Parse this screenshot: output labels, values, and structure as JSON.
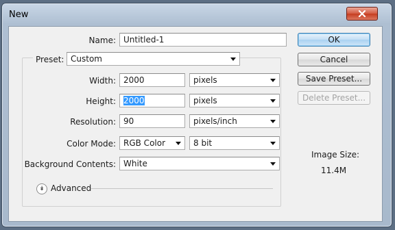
{
  "window": {
    "title": "New"
  },
  "fields": {
    "name": {
      "label": "Name:",
      "value": "Untitled-1"
    },
    "preset": {
      "label": "Preset:",
      "value": "Custom"
    },
    "width": {
      "label": "Width:",
      "value": "2000",
      "unit": "pixels"
    },
    "height": {
      "label": "Height:",
      "value": "2000",
      "unit": "pixels"
    },
    "resolution": {
      "label": "Resolution:",
      "value": "90",
      "unit": "pixels/inch"
    },
    "color_mode": {
      "label": "Color Mode:",
      "value": "RGB Color",
      "depth": "8 bit"
    },
    "background": {
      "label": "Background Contents:",
      "value": "White"
    },
    "advanced": {
      "label": "Advanced"
    }
  },
  "buttons": {
    "ok": "OK",
    "cancel": "Cancel",
    "save_preset": "Save Preset...",
    "delete_preset": "Delete Preset..."
  },
  "image_size": {
    "label": "Image Size:",
    "value": "11.4M"
  }
}
